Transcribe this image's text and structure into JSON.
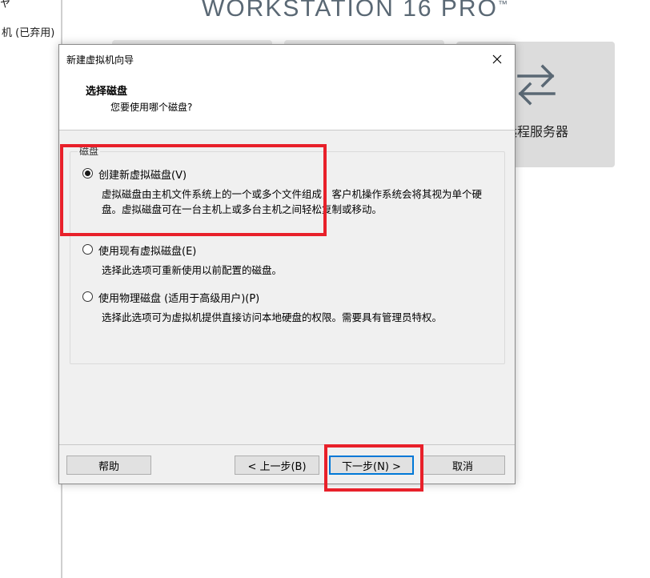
{
  "background": {
    "left_pane_text_top": "ヤ",
    "left_pane_item": "机 (已弃用)",
    "brand_text": "WORKSTATION 16 PRO",
    "brand_tm": "™",
    "tile_label": "远程服务器",
    "tile_icon": "swap-arrows-icon"
  },
  "dialog": {
    "title": "新建虚拟机向导",
    "header_title": "选择磁盘",
    "header_subtitle": "您要使用哪个磁盘?",
    "group_label": "磁盘",
    "options": [
      {
        "label": "创建新虚拟磁盘(V)",
        "checked": true,
        "description": "虚拟磁盘由主机文件系统上的一个或多个文件组成，客户机操作系统会将其视为单个硬盘。虚拟磁盘可在一台主机上或多台主机之间轻松复制或移动。"
      },
      {
        "label": "使用现有虚拟磁盘(E)",
        "checked": false,
        "description": "选择此选项可重新使用以前配置的磁盘。"
      },
      {
        "label": "使用物理磁盘 (适用于高级用户)(P)",
        "checked": false,
        "description": "选择此选项可为虚拟机提供直接访问本地硬盘的权限。需要具有管理员特权。"
      }
    ],
    "buttons": {
      "help": "帮助",
      "back": "< 上一步(B)",
      "next": "下一步(N) >",
      "cancel": "取消"
    }
  },
  "colors": {
    "annotation": "#e8202a",
    "dialog_bg": "#f0f0f0",
    "default_button_border": "#0078d7"
  }
}
